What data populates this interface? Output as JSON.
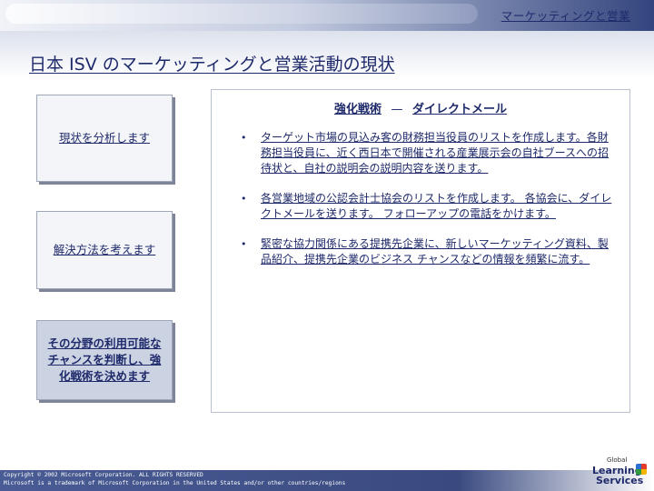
{
  "header": {
    "section_label": "マーケッティングと営業"
  },
  "slide": {
    "title": "日本 ISV のマーケッティングと営業活動の現状"
  },
  "steps": [
    {
      "label": "現状を分析します"
    },
    {
      "label": "解決方法を考えます"
    },
    {
      "label": "その分野の利用可能なチャンスを判断し、強化戦術を決めます"
    }
  ],
  "content": {
    "heading_left": "強化戦術",
    "heading_sep": "—",
    "heading_right": "ダイレクトメール",
    "bullets": [
      {
        "bullet": "•",
        "text": "ターゲット市場の見込み客の財務担当役員のリストを作成します。各財務担当役員に、近く西日本で開催される産業展示会の自社ブースへの招待状と、自社の説明会の説明内容を送ります。"
      },
      {
        "bullet": "•",
        "text": "各営業地域の公認会計士協会のリストを作成します。 各協会に、ダイレクトメールを送ります。 フォローアップの電話をかけます。"
      },
      {
        "bullet": "•",
        "text": "緊密な協力関係にある提携先企業に、新しいマーケッティング資料、製品紹介、提携先企業のビジネス チャンスなどの情報を頻繁に流す。"
      }
    ]
  },
  "footer": {
    "copyright": "Copyright © 2002 Microsoft Corporation. ALL RIGHTS RESERVED",
    "trademark": "Microsoft is a trademark of Microsoft Corporation in the United States and/or other countries/regions"
  },
  "logo": {
    "line_small": "Global",
    "line1": "Learning",
    "line2": "Services"
  },
  "colors": {
    "text_primary": "#1f2a6b",
    "footer_bar": "#3a4a80",
    "step_highlight": "#cbd3e3"
  }
}
